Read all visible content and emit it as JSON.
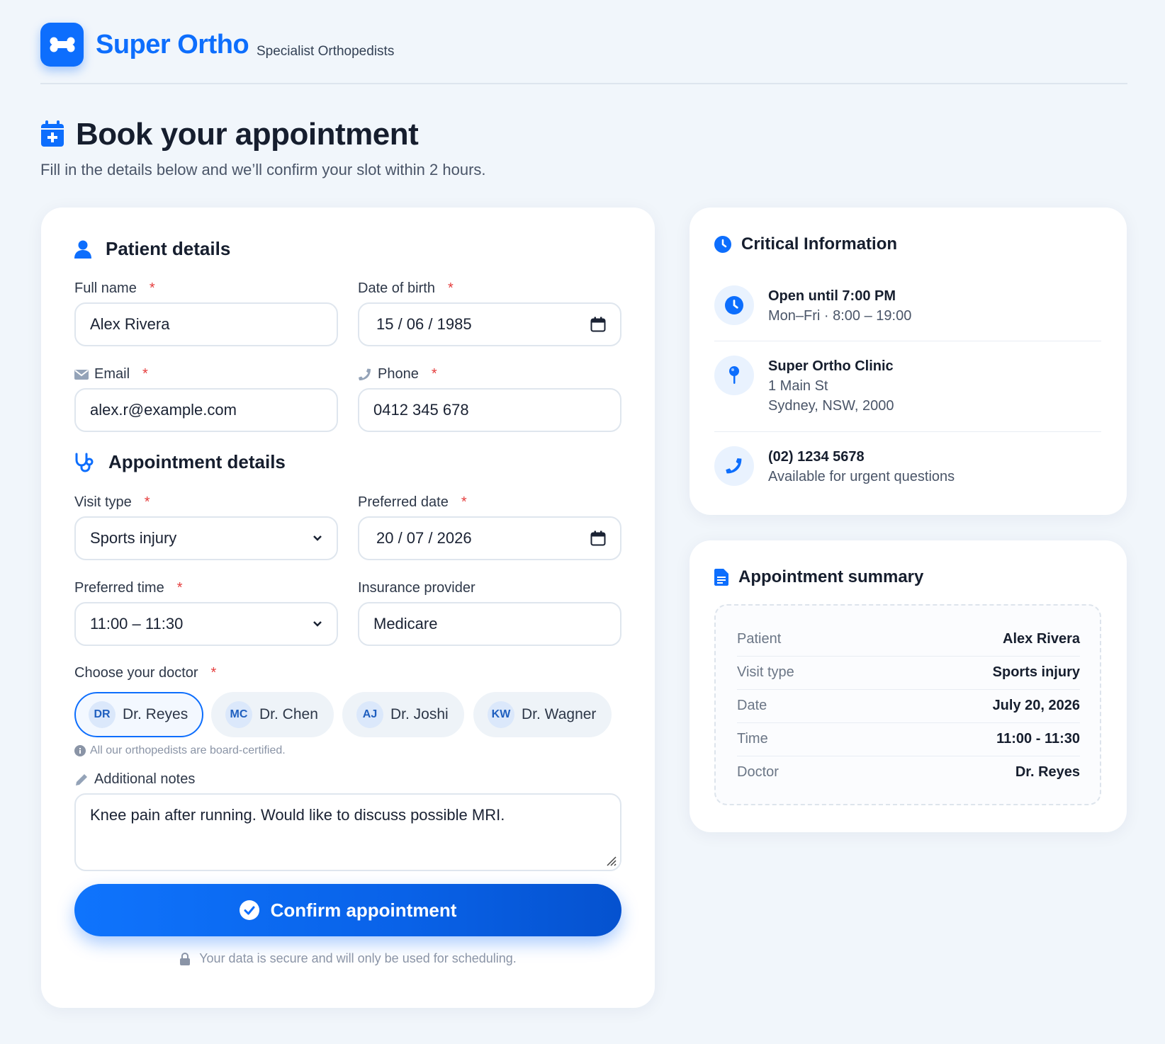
{
  "brand": {
    "name": "Super Ortho",
    "tagline": "Specialist Orthopedists"
  },
  "page": {
    "title": "Book your appointment",
    "subtitle": "Fill in the details below and we’ll confirm your slot within 2 hours."
  },
  "patient": {
    "section_title": "Patient details",
    "full_name_label": "Full name",
    "full_name_value": "Alex Rivera",
    "dob_label": "Date of birth",
    "dob_value": "15 / 06 / 1985",
    "email_label": "Email",
    "email_value": "alex.r@example.com",
    "phone_label": "Phone",
    "phone_value": "0412 345 678"
  },
  "appointment": {
    "section_title": "Appointment details",
    "visit_type_label": "Visit type",
    "visit_type_value": "Sports injury",
    "preferred_date_label": "Preferred date",
    "preferred_date_value": "20 / 07 / 2026",
    "preferred_time_label": "Preferred time",
    "preferred_time_value": "11:00 – 11:30",
    "insurance_label": "Insurance provider",
    "insurance_value": "Medicare",
    "doctor_label": "Choose your doctor",
    "doctors": [
      {
        "initials": "DR",
        "name": "Dr. Reyes",
        "selected": true
      },
      {
        "initials": "MC",
        "name": "Dr. Chen",
        "selected": false
      },
      {
        "initials": "AJ",
        "name": "Dr. Joshi",
        "selected": false
      },
      {
        "initials": "KW",
        "name": "Dr. Wagner",
        "selected": false
      }
    ],
    "doctor_hint": "All our orthopedists are board-certified.",
    "notes_label": "Additional notes",
    "notes_value": "Knee pain after running. Would like to discuss possible MRI.",
    "required_mark": "*"
  },
  "actions": {
    "confirm_label": "Confirm appointment",
    "secure_note": "Your data is secure and will only be used for scheduling."
  },
  "critical_info": {
    "title": "Critical Information",
    "hours_title": "Open until 7:00 PM",
    "hours_detail": "Mon–Fri · 8:00 – 19:00",
    "clinic_name": "Super Ortho Clinic",
    "clinic_street": "1 Main St",
    "clinic_city": "Sydney, NSW, 2000",
    "phone": "(02) 1234 5678",
    "phone_note": "Available for urgent questions"
  },
  "summary": {
    "title": "Appointment summary",
    "rows": [
      {
        "key": "Patient",
        "value": "Alex Rivera"
      },
      {
        "key": "Visit type",
        "value": "Sports injury"
      },
      {
        "key": "Date",
        "value": "July 20, 2026"
      },
      {
        "key": "Time",
        "value": "11:00 - 11:30"
      },
      {
        "key": "Doctor",
        "value": "Dr. Reyes"
      }
    ]
  },
  "colors": {
    "accent": "#0d6efd",
    "required": "#e53e3e",
    "background": "#f1f6fb"
  }
}
